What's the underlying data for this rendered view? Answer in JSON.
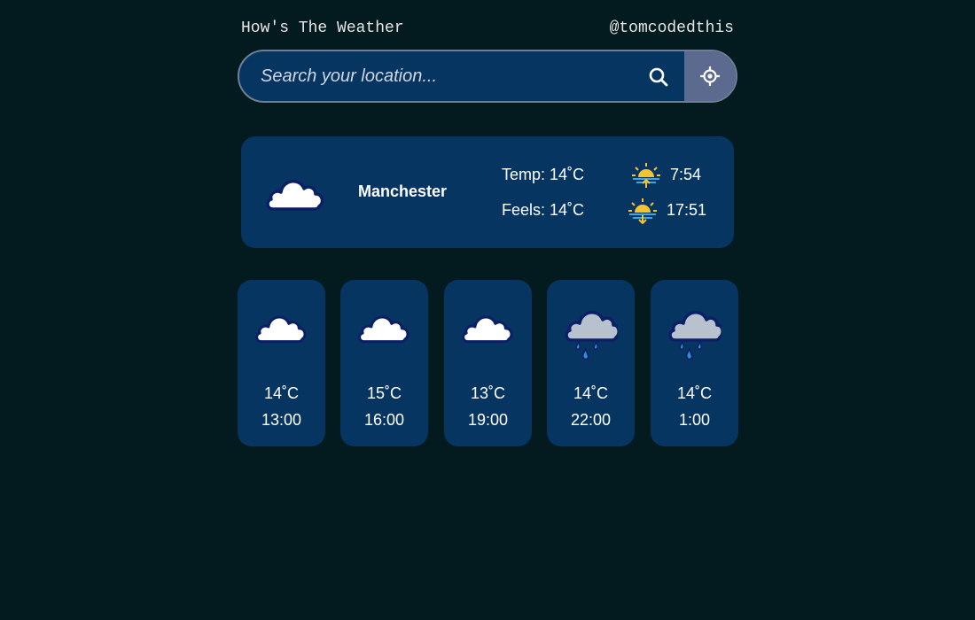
{
  "header": {
    "title": "How's The Weather",
    "handle": "@tomcodedthis"
  },
  "search": {
    "placeholder": "Search your location...",
    "value": "",
    "search_icon": "search-icon",
    "locate_icon": "crosshair-icon"
  },
  "current": {
    "icon": "cloud-icon",
    "city": "Manchester",
    "temp": "Temp: 14˚C",
    "feels": "Feels: 14˚C",
    "sunrise": "7:54",
    "sunset": "17:51"
  },
  "forecast": [
    {
      "icon": "cloud-icon",
      "temp": "14˚C",
      "time": "13:00"
    },
    {
      "icon": "cloud-icon",
      "temp": "15˚C",
      "time": "16:00"
    },
    {
      "icon": "cloud-icon",
      "temp": "13˚C",
      "time": "19:00"
    },
    {
      "icon": "rain-cloud-icon",
      "temp": "14˚C",
      "time": "22:00"
    },
    {
      "icon": "rain-cloud-icon",
      "temp": "14˚C",
      "time": "1:00"
    }
  ],
  "colors": {
    "background": "#031b1f",
    "card": "#073561",
    "locate_button": "#5d6a90",
    "sun": "#f4c430"
  }
}
